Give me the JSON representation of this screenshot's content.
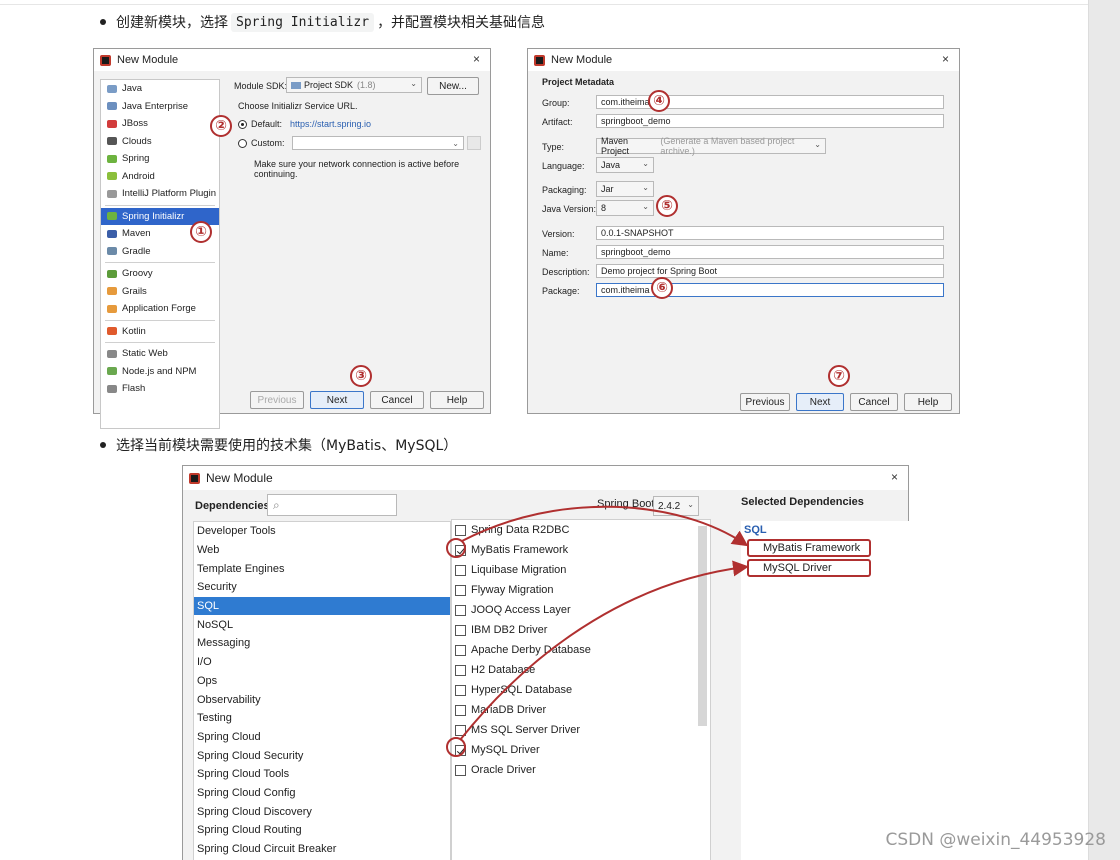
{
  "bullets": {
    "first_pre": "创建新模块，选择",
    "first_code": "Spring Initializr",
    "first_post": "，并配置模块相关基础信息",
    "second": "选择当前模块需要使用的技术集（MyBatis、MySQL）"
  },
  "dialog1": {
    "title": "New Module",
    "close": "×",
    "left_items": [
      {
        "label": "Java",
        "color": "#7a9cc6"
      },
      {
        "label": "Java Enterprise",
        "color": "#6c8fbf"
      },
      {
        "label": "JBoss",
        "color": "#d23b3b"
      },
      {
        "label": "Clouds",
        "color": "#555555"
      },
      {
        "label": "Spring",
        "color": "#6db33f"
      },
      {
        "label": "Android",
        "color": "#8bbf3b"
      },
      {
        "label": "IntelliJ Platform Plugin",
        "color": "#999999"
      },
      {
        "label": "Spring Initializr",
        "color": "#6db33f"
      },
      {
        "label": "Maven",
        "color": "#3b5ea8"
      },
      {
        "label": "Gradle",
        "color": "#6b8aa8"
      },
      {
        "label": "Groovy",
        "color": "#5c9c3a"
      },
      {
        "label": "Grails",
        "color": "#e69a3c"
      },
      {
        "label": "Application Forge",
        "color": "#e69a3c"
      },
      {
        "label": "Kotlin",
        "color": "#e05a2c"
      },
      {
        "label": "Static Web",
        "color": "#888888"
      },
      {
        "label": "Node.js and NPM",
        "color": "#6aa84f"
      },
      {
        "label": "Flash",
        "color": "#888888"
      }
    ],
    "sdk_label": "Module SDK:",
    "sdk_value": "Project SDK",
    "sdk_version": "(1.8)",
    "new_button": "New...",
    "service_url_label": "Choose Initializr Service URL.",
    "default_label": "Default:",
    "default_url": "https://start.spring.io",
    "custom_label": "Custom:",
    "note": "Make sure your network connection is active before continuing.",
    "previous": "Previous",
    "next": "Next",
    "cancel": "Cancel",
    "help": "Help",
    "markers": [
      "①",
      "②",
      "③"
    ]
  },
  "dialog2": {
    "title": "New Module",
    "close": "×",
    "section": "Project Metadata",
    "fields": {
      "group_label": "Group:",
      "group": "com.itheima",
      "artifact_label": "Artifact:",
      "artifact": "springboot_demo",
      "type_label": "Type:",
      "type": "Maven Project",
      "type_hint": "(Generate a Maven based project archive.)",
      "language_label": "Language:",
      "language": "Java",
      "packaging_label": "Packaging:",
      "packaging": "Jar",
      "java_version_label": "Java Version:",
      "java_version": "8",
      "version_label": "Version:",
      "version": "0.0.1-SNAPSHOT",
      "name_label": "Name:",
      "name": "springboot_demo",
      "description_label": "Description:",
      "description": "Demo project for Spring Boot",
      "package_label": "Package:",
      "package": "com.itheima"
    },
    "previous": "Previous",
    "next": "Next",
    "cancel": "Cancel",
    "help": "Help",
    "markers": [
      "④",
      "⑤",
      "⑥",
      "⑦"
    ]
  },
  "dialog3": {
    "title": "New Module",
    "close": "×",
    "dependencies_label": "Dependencies",
    "spring_boot_label": "Spring Boot",
    "spring_boot_version": "2.4.2",
    "selected_title": "Selected Dependencies",
    "categories": [
      "Developer Tools",
      "Web",
      "Template Engines",
      "Security",
      "SQL",
      "NoSQL",
      "Messaging",
      "I/O",
      "Ops",
      "Observability",
      "Testing",
      "Spring Cloud",
      "Spring Cloud Security",
      "Spring Cloud Tools",
      "Spring Cloud Config",
      "Spring Cloud Discovery",
      "Spring Cloud Routing",
      "Spring Cloud Circuit Breaker"
    ],
    "selected_category": "SQL",
    "deps": [
      {
        "label": "Spring Data R2DBC",
        "checked": false
      },
      {
        "label": "MyBatis Framework",
        "checked": true
      },
      {
        "label": "Liquibase Migration",
        "checked": false
      },
      {
        "label": "Flyway Migration",
        "checked": false
      },
      {
        "label": "JOOQ Access Layer",
        "checked": false
      },
      {
        "label": "IBM DB2 Driver",
        "checked": false
      },
      {
        "label": "Apache Derby Database",
        "checked": false
      },
      {
        "label": "H2 Database",
        "checked": false
      },
      {
        "label": "HyperSQL Database",
        "checked": false
      },
      {
        "label": "MariaDB Driver",
        "checked": false
      },
      {
        "label": "MS SQL Server Driver",
        "checked": false
      },
      {
        "label": "MySQL Driver",
        "checked": true
      },
      {
        "label": "Oracle Driver",
        "checked": false
      }
    ],
    "selected_group": "SQL",
    "selected_items": [
      "MyBatis Framework",
      "MySQL Driver"
    ]
  },
  "watermark": "CSDN @weixin_44953928",
  "colors": {
    "accent_red": "#b03030",
    "selection_blue": "#2f7bd1"
  }
}
